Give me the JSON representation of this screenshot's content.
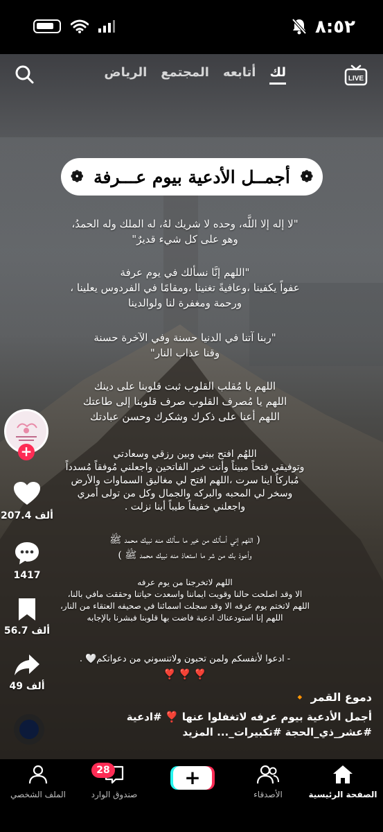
{
  "status_bar": {
    "time": "٨:٥٢"
  },
  "topnav": {
    "tabs": [
      "الرياض",
      "المجتمع",
      "أتابعه",
      "لك"
    ],
    "active_tab": "لك"
  },
  "title": "أجمــل الأدعية بيوم عـــرفة",
  "dua_blocks": [
    [
      "\"لا إله إلا اللَّه، وحده لا شريك لهُ، له الملك وله الحمدُ،",
      "وهو على كل شيء قديرٌ\""
    ],
    [
      "\"اللهم إنَّا نسألك في يوم عرفة",
      "عفواً يكفينا ،وعافيةً تغنينا ،ومقامًا في الفردوس يعلينا ،",
      "ورحمة ومغفرة لنا ولوالدينا"
    ],
    [
      "\"ربنا آتنا في الدنيا حسنة وفي الآخرة حسنة",
      "وقنا عذاب النار\""
    ],
    [
      "اللهم يا مُقلب القلوب ثبت قلوبنا على دينك",
      "اللهم يا مُصرف القلوب صرف قلوبنا إلى طاعتك",
      "اللهم أعنا على ذكرك وشكرك وحسن عبادتك"
    ],
    [
      "اللهُم افتح بيني وبين رزقي وسعادتي",
      "وتوفيقي فتحاً مبيناً وأنت خير الفاتحين واجعلني مُوفقاً مُسدداً",
      "مُباركاً اينا سرت ،اللهم افتح لي مغاليق السماوات والأرض",
      "وسخر لي المحبه والبركه والجمال وكل من تولى أمري",
      "واجعلني خفيفاً طيباً أينا نزلت ."
    ],
    [
      "( اللهم إني أسألك من خير ما سألك منه نبيك محمد ﷺ",
      "وأعوذ بك من شر ما استعاذ منه نبيك محمد ﷺ )"
    ],
    [
      "اللهم لاتخرجنا من يوم عرفه",
      "الا وقد اصلحت حالنا وقويت ايماننا واسعدت حياتنا وحققت مافي بالنا،",
      "اللهم لاتختم يوم عرفه الا وقد سجلت اسمائنا في صحيفه العتقاء من النار،",
      "اللهم إنا استودعناك ادعية فاضت بها قلوبنا فبشرنا بالإجابه"
    ],
    [
      "- ادعوا لأنفسكم ولمن تحبون ولاتنسوني من دعواتكم🤍 .",
      "❣️ ❣️ ❣️"
    ]
  ],
  "sidebar": {
    "likes": "207.4 ألف",
    "comments": "1417",
    "saves": "56.7 ألف",
    "shares": "49 ألف"
  },
  "caption": {
    "author": "دموع القمر 🔸",
    "line1": "أجمل الأدعية بيوم عرفه لاتغفلوا عنها ❣️ #ادعية",
    "line2": "#عشر_ذي_الحجة #تكبيرات_... المزيد"
  },
  "bottom_nav": {
    "home": "الصفحة الرئيسية",
    "friends": "الأصدقاء",
    "inbox": "صندوق الوارد",
    "inbox_badge": "28",
    "profile": "الملف الشخصي"
  },
  "colors": {
    "accent": "#fe2c55",
    "cyan": "#25f4ee"
  }
}
